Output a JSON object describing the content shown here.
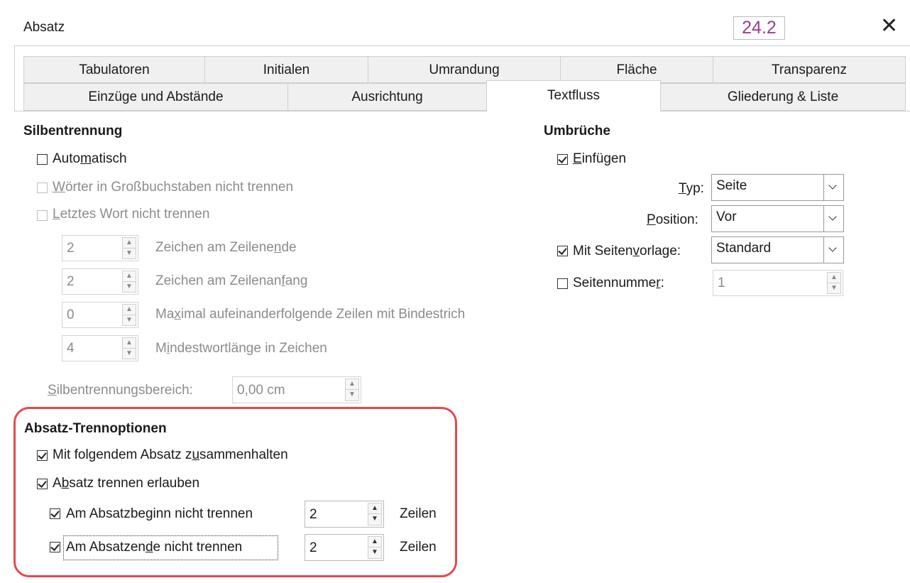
{
  "window": {
    "title": "Absatz",
    "version_badge": "24.2"
  },
  "tabs_row1": [
    "Tabulatoren",
    "Initialen",
    "Umrandung",
    "Fläche",
    "Transparenz"
  ],
  "tabs_row2": [
    "Einzüge und Abstände",
    "Ausrichtung",
    "Textfluss",
    "Gliederung & Liste"
  ],
  "active_tab": "Textfluss",
  "hyphenation": {
    "heading": "Silbentrennung",
    "automatic": {
      "pre": "Auto",
      "u": "m",
      "post": "atisch",
      "checked": false
    },
    "no_caps": {
      "pre": "",
      "u": "W",
      "post": "örter in Großbuchstaben nicht trennen",
      "checked": false
    },
    "no_last_word": {
      "pre": "",
      "u": "L",
      "post": "etztes Wort nicht trennen",
      "checked": false
    },
    "chars_end": {
      "value": "2",
      "pre": "Zeichen am Zeilene",
      "u": "n",
      "post": "de"
    },
    "chars_start": {
      "value": "2",
      "pre": "Zeichen am Zeilenan",
      "u": "f",
      "post": "ang"
    },
    "max_lines": {
      "value": "0",
      "pre": "Ma",
      "u": "x",
      "post": "imal aufeinanderfolgende Zeilen mit Bindestrich"
    },
    "min_word": {
      "value": "4",
      "pre": "M",
      "u": "i",
      "post": "ndestwortlänge in Zeichen"
    },
    "zone": {
      "pre": "",
      "u": "S",
      "post": "ilbentrennungsbereich:",
      "value": "0,00 cm"
    }
  },
  "breaks": {
    "heading": "Umbrüche",
    "insert": {
      "pre": "",
      "u": "E",
      "post": "infügen",
      "checked": true
    },
    "type": {
      "pre": "",
      "u": "T",
      "post": "yp:",
      "value": "Seite"
    },
    "position": {
      "pre": "",
      "u": "P",
      "post": "osition:",
      "value": "Vor"
    },
    "page_style": {
      "pre": "Mit Seiten",
      "u": "v",
      "post": "orlage:",
      "value": "Standard",
      "checked": true
    },
    "page_number": {
      "pre": "Seitennumme",
      "u": "r",
      "post": ":",
      "value": "1",
      "checked": false
    }
  },
  "split_options": {
    "heading": "Absatz-Trennoptionen",
    "keep_with_next": {
      "pre": "Mit folgendem Absatz z",
      "u": "u",
      "post": "sammenhalten",
      "checked": true
    },
    "allow_split": {
      "pre": "A",
      "u": "b",
      "post": "satz trennen erlauben",
      "checked": true
    },
    "orphan": {
      "pre": "Am Absatzbe",
      "u": "g",
      "post": "inn nicht trennen",
      "value": "2",
      "unit": "Zeilen",
      "checked": true
    },
    "widow": {
      "pre": "Am Absatzen",
      "u": "d",
      "post": "e nicht trennen",
      "value": "2",
      "unit": "Zeilen",
      "checked": true
    }
  }
}
